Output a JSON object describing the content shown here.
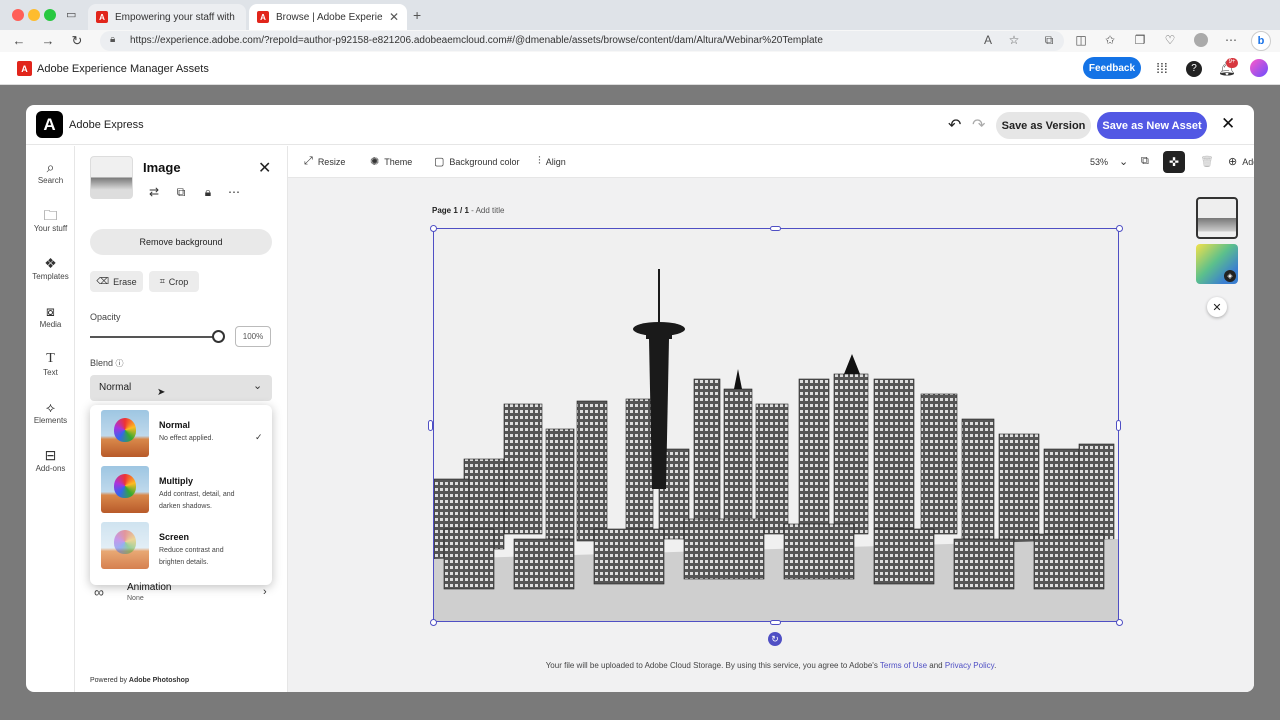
{
  "browser": {
    "tabs": [
      {
        "title": "Empowering your staff with Ge"
      },
      {
        "title": "Browse | Adobe Experience Ma"
      }
    ],
    "url": "https://experience.adobe.com/?repoId=author-p92158-e821206.adobeaemcloud.com#/@dmenable/assets/browse/content/dam/Altura/Webinar%20Template"
  },
  "aem": {
    "title": "Adobe Experience Manager Assets",
    "feedback": "Feedback",
    "notif_badge": "9+"
  },
  "express": {
    "title": "Adobe Express",
    "save_version": "Save as Version",
    "save_new": "Save as New Asset"
  },
  "rail": [
    {
      "label": "Search"
    },
    {
      "label": "Your stuff"
    },
    {
      "label": "Templates"
    },
    {
      "label": "Media"
    },
    {
      "label": "Text"
    },
    {
      "label": "Elements"
    },
    {
      "label": "Add-ons"
    }
  ],
  "panel": {
    "title": "Image",
    "remove_bg": "Remove background",
    "erase": "Erase",
    "crop": "Crop",
    "opacity_label": "Opacity",
    "opacity_value": "100%",
    "opacity_fraction": 1.0,
    "blend_label": "Blend",
    "blend_selected": "Normal",
    "blend_options": [
      {
        "name": "Normal",
        "desc": "No effect applied."
      },
      {
        "name": "Multiply",
        "desc": "Add contrast, detail, and darken shadows."
      },
      {
        "name": "Screen",
        "desc": "Reduce contrast and brighten details."
      }
    ],
    "animation_title": "Animation",
    "animation_value": "None",
    "powered_prefix": "Powered by",
    "powered_brand": "Adobe Photoshop"
  },
  "toolbar": {
    "resize": "Resize",
    "theme": "Theme",
    "bg_color": "Background color",
    "align": "Align",
    "zoom": "53%",
    "add": "Add"
  },
  "canvas": {
    "page_label": "Page 1 / 1",
    "add_title": "Add title",
    "terms_prefix": "Your file will be uploaded to Adobe Cloud Storage. By using this service, you agree to Adobe's",
    "terms_link": "Terms of Use",
    "terms_and": "and",
    "privacy_link": "Privacy Policy"
  }
}
